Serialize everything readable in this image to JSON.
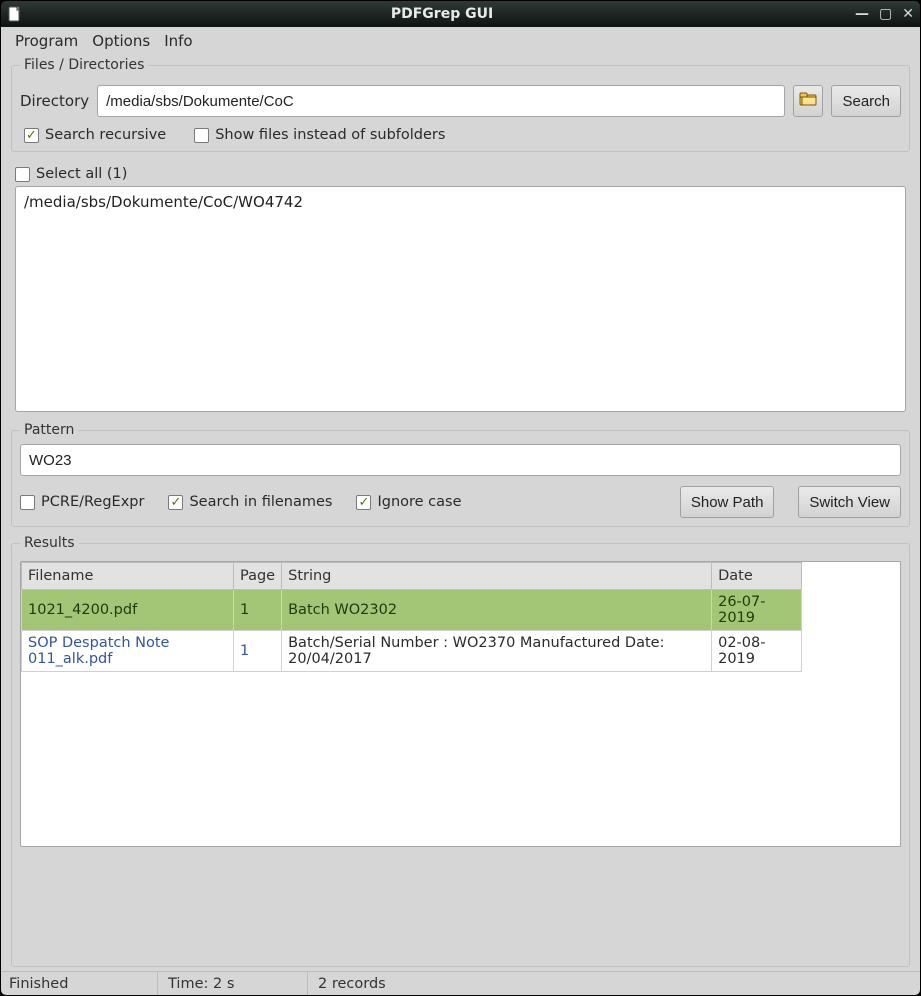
{
  "window": {
    "title": "PDFGrep GUI"
  },
  "menubar": {
    "items": [
      "Program",
      "Options",
      "Info"
    ]
  },
  "files_group": {
    "legend": "Files / Directories",
    "dir_label": "Directory",
    "dir_value": "/media/sbs/Dokumente/CoC",
    "search_btn": "Search",
    "recursive_label": "Search recursive",
    "recursive_checked": true,
    "show_files_label": "Show files instead of subfolders",
    "show_files_checked": false,
    "select_all_label": "Select all (1)",
    "select_all_checked": false,
    "list_items": [
      "/media/sbs/Dokumente/CoC/WO4742"
    ]
  },
  "pattern_group": {
    "legend": "Pattern",
    "value": "WO23",
    "pcre_label": "PCRE/RegExpr",
    "pcre_checked": false,
    "infilenames_label": "Search in filenames",
    "infilenames_checked": true,
    "ignorecase_label": "Ignore case",
    "ignorecase_checked": true,
    "show_path_btn": "Show Path",
    "switch_view_btn": "Switch View"
  },
  "results_group": {
    "legend": "Results",
    "columns": [
      "Filename",
      "Page",
      "String",
      "Date"
    ],
    "rows": [
      {
        "filename": "1021_4200.pdf",
        "page": "1",
        "string": "Batch WO2302",
        "date": "26-07-2019",
        "selected": true
      },
      {
        "filename": "SOP Despatch Note 011_alk.pdf",
        "page": "1",
        "string": "Batch/Serial Number : WO2370 Manufactured Date: 20/04/2017",
        "date": "02-08-2019",
        "selected": false
      }
    ]
  },
  "statusbar": {
    "state": "Finished",
    "time": "Time: 2 s",
    "records": "2  records"
  }
}
